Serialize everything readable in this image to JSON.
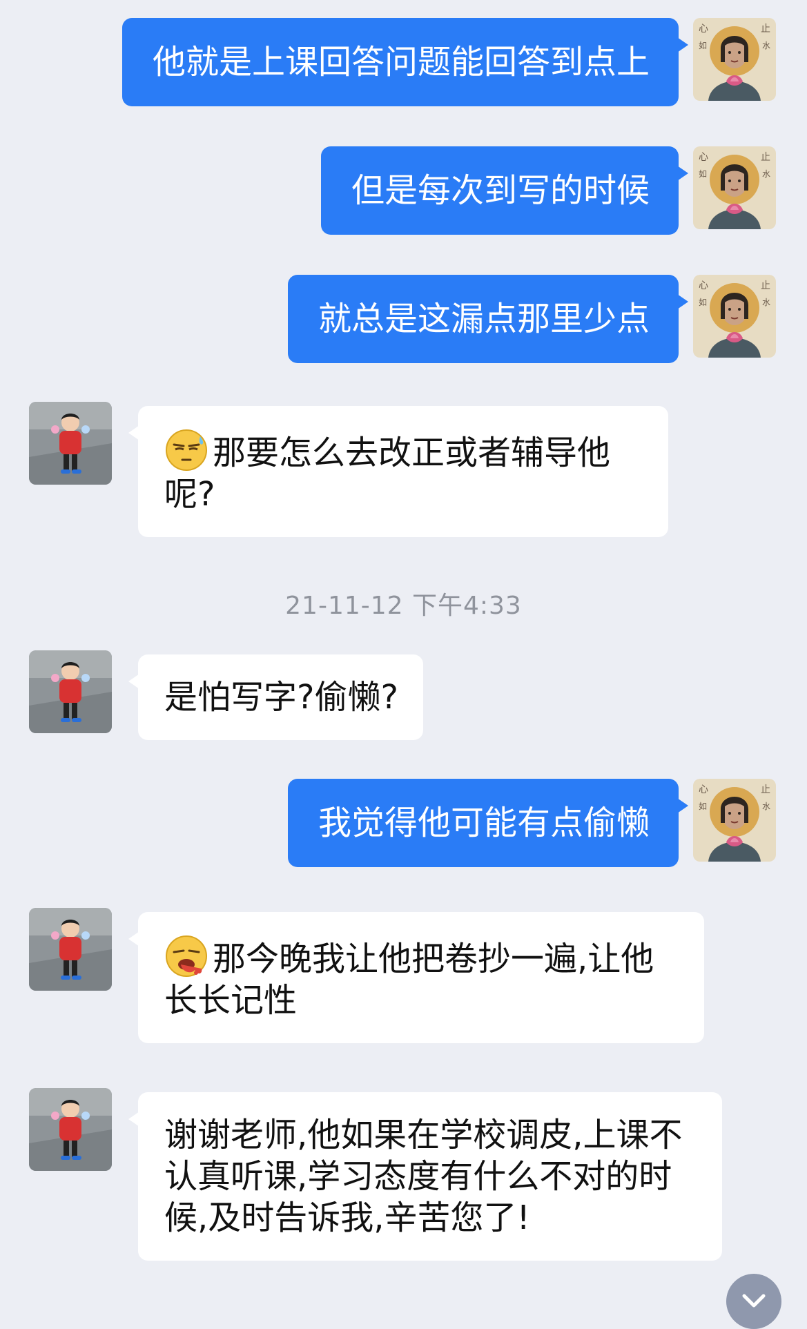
{
  "messages": [
    {
      "side": "sent",
      "text": "他就是上课回答问题能回答到点上"
    },
    {
      "side": "sent",
      "text": "但是每次到写的时候"
    },
    {
      "side": "sent",
      "text": "就总是这漏点那里少点"
    },
    {
      "side": "received",
      "emoji": "sweat-squint-emoji",
      "text": "那要怎么去改正或者辅导他呢?"
    },
    {
      "side": "received",
      "text": "是怕写字?偷懒?"
    },
    {
      "side": "sent",
      "text": "我觉得他可能有点偷懒"
    },
    {
      "side": "received",
      "emoji": "vomit-emoji",
      "text": "那今晚我让他把卷抄一遍,让他长长记性"
    },
    {
      "side": "received",
      "text": "谢谢老师,他如果在学校调皮,上课不认真听课,学习态度有什么不对的时候,及时告诉我,辛苦您了!"
    }
  ],
  "timestamp": "21-11-12 下午4:33",
  "colors": {
    "background": "#eceef4",
    "sent_bubble": "#2a7cf6",
    "received_bubble": "#ffffff",
    "timestamp_text": "#8f939c"
  },
  "icons": {
    "self_avatar": "painted-portrait-avatar",
    "contact_avatar": "child-photo-avatar",
    "scroll_button": "chevron-down-icon"
  }
}
